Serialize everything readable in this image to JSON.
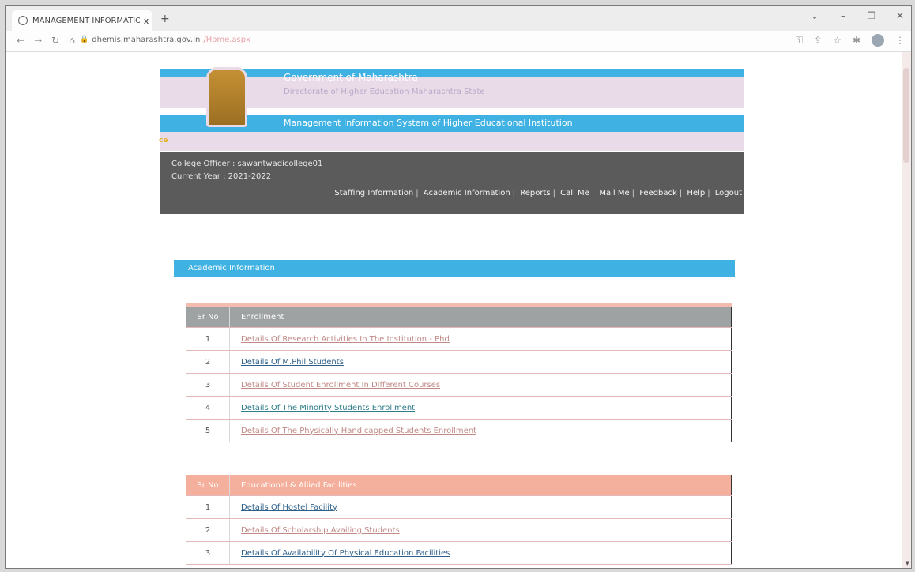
{
  "browser": {
    "tab_title": "MANAGEMENT INFORMATION",
    "tab_close": "x",
    "new_tab": "+",
    "url_domain": "dhemis.maharashtra.gov.in",
    "url_path": "/Home.aspx"
  },
  "header": {
    "gov_title": "Government of Maharashtra",
    "dept_title": "Directorate of Higher Education Maharashtra State",
    "mis_title": "Management Information System of Higher Educational Institution",
    "ticker": "ce"
  },
  "user": {
    "college_line": "College Officer : sawantwadicollege01",
    "year_line": "Current Year : 2021-2022"
  },
  "topnav": [
    "Staffing Information",
    "Academic Information",
    "Reports",
    "Call Me",
    "Mail Me",
    "Feedback",
    "Help",
    "Logout"
  ],
  "section_title": "Academic Information",
  "enrollment": {
    "col_sr": "Sr No",
    "title": "Enrollment",
    "rows": [
      {
        "sr": "1",
        "label": "Details Of Research Activities In The Institution - Phd"
      },
      {
        "sr": "2",
        "label": "Details Of M.Phil Students"
      },
      {
        "sr": "3",
        "label": "Details Of Student Enrollment In Different Courses"
      },
      {
        "sr": "4",
        "label": "Details Of The Minority Students Enrollment"
      },
      {
        "sr": "5",
        "label": "Details Of The Physically Handicapped Students Enrollment"
      }
    ]
  },
  "facilities": {
    "col_sr": "Sr No",
    "title": "Educational & Allied Facilities",
    "rows": [
      {
        "sr": "1",
        "label": "Details Of Hostel Facility"
      },
      {
        "sr": "2",
        "label": "Details Of Scholarship Availing Students"
      },
      {
        "sr": "3",
        "label": "Details Of Availability Of Physical Education Facilities"
      }
    ]
  }
}
